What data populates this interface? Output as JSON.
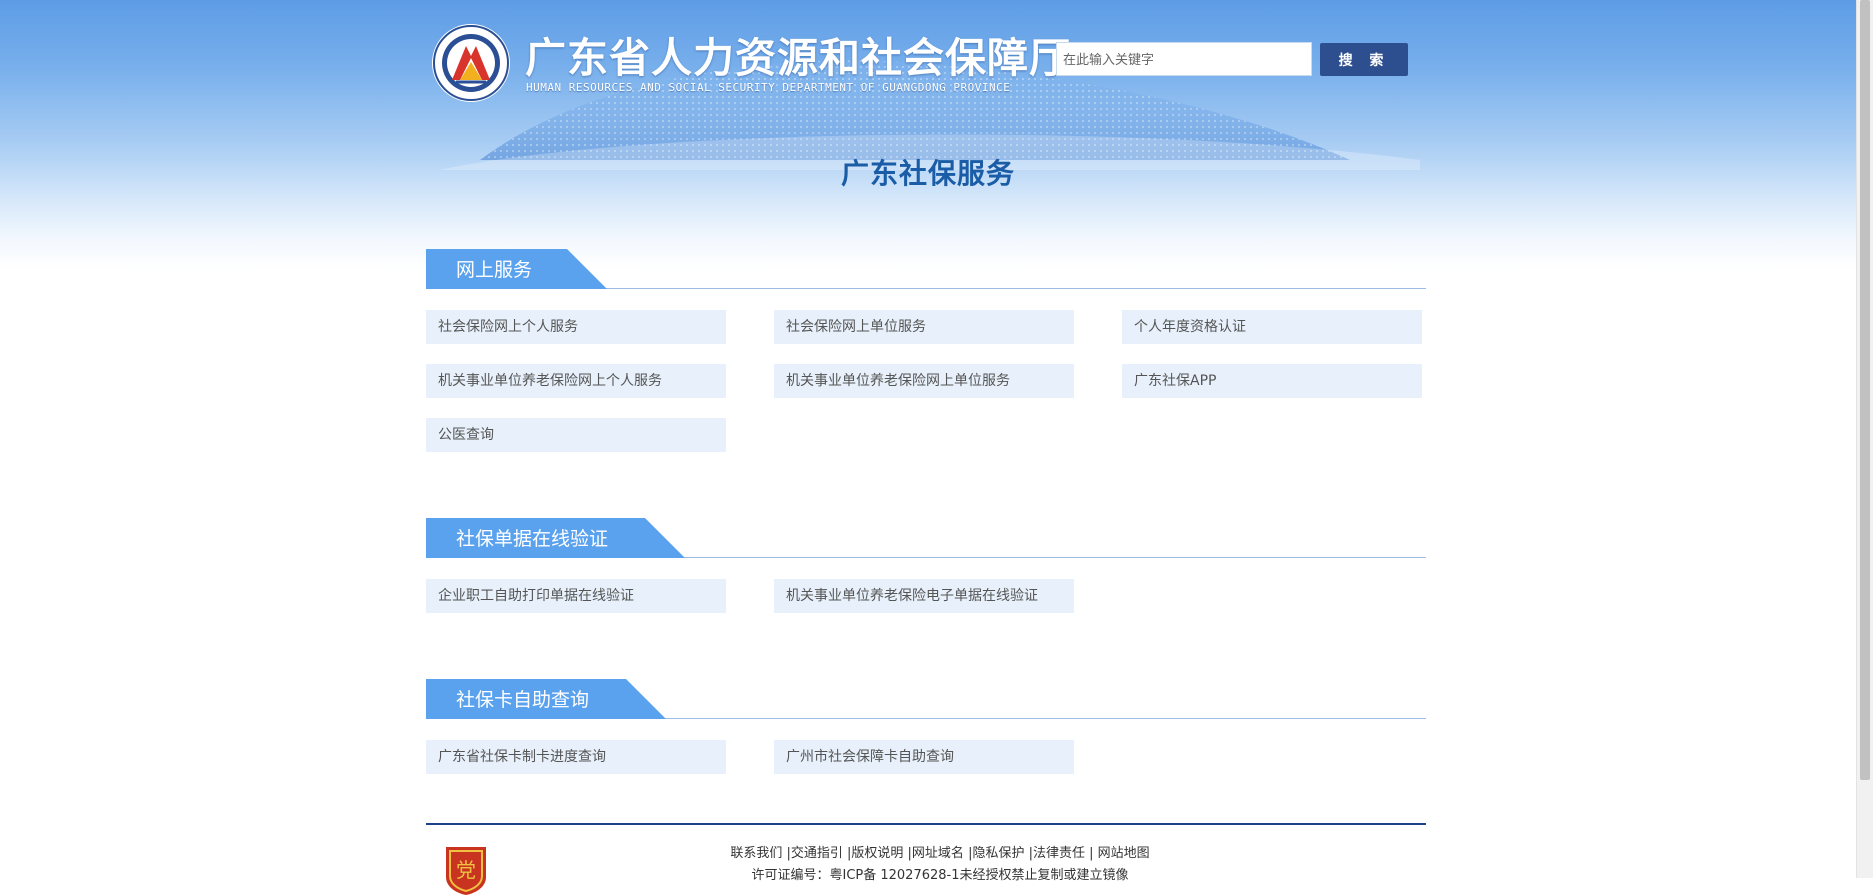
{
  "header": {
    "title": "广东省人力资源和社会保障厅",
    "subtitle": "HUMAN RESOURCES AND SOCIAL SECURITY DEPARTMENT OF GUANGDONG PROVINCE",
    "search_placeholder": "在此输入关键字",
    "search_button": "搜 索"
  },
  "page_title": "广东社保服务",
  "sections": [
    {
      "title": "网上服务",
      "links": [
        "社会保险网上个人服务",
        "社会保险网上单位服务",
        "个人年度资格认证",
        "机关事业单位养老保险网上个人服务",
        "机关事业单位养老保险网上单位服务",
        "广东社保APP",
        "公医查询"
      ]
    },
    {
      "title": "社保单据在线验证",
      "links": [
        "企业职工自助打印单据在线验证",
        "机关事业单位养老保险电子单据在线验证"
      ]
    },
    {
      "title": "社保卡自助查询",
      "links": [
        "广东省社保卡制卡进度查询",
        "广州市社会保障卡自助查询"
      ]
    }
  ],
  "footer": {
    "links": [
      "联系我们",
      "交通指引",
      "版权说明",
      "网址域名",
      "隐私保护",
      "法律责任",
      "网站地图"
    ],
    "license": "许可证编号：粤ICP备 12027628-1未经授权禁止复制或建立镜像"
  },
  "colors": {
    "tab": "#5aa2ee",
    "title": "#1a5ca6",
    "button": "#2d4f8f",
    "link_bg": "#e8f1fb",
    "footer_rule": "#1e3f8c"
  }
}
